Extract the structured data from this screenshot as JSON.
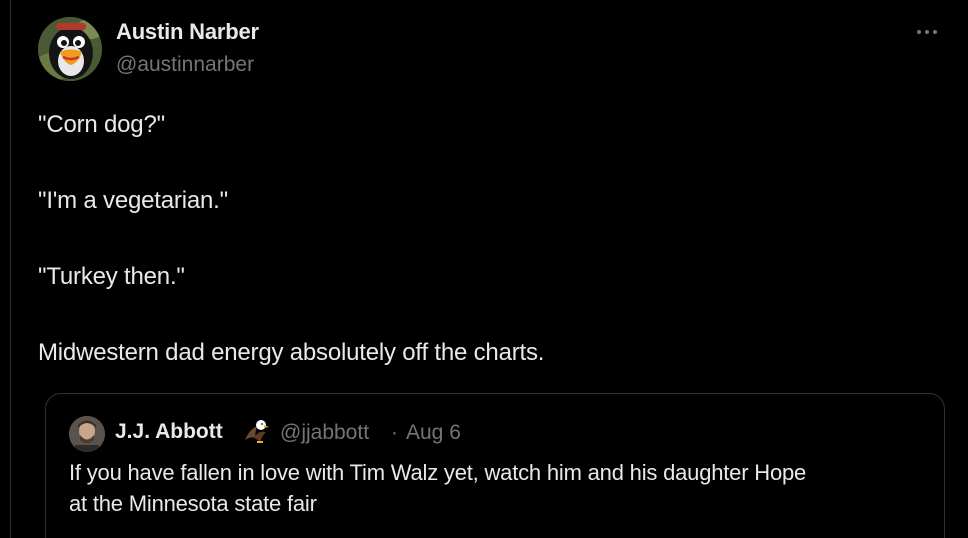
{
  "tweet": {
    "author": {
      "display_name": "Austin Narber",
      "handle": "@austinnarber",
      "avatar_icon": "penguin-avatar-icon"
    },
    "more_icon": "more-horizontal-icon",
    "lines": [
      "\"Corn dog?\"",
      "\"I'm a vegetarian.\"",
      "\"Turkey then.\"",
      "Midwestern dad energy absolutely off the charts."
    ]
  },
  "quoted_tweet": {
    "display_name": "J.J. Abbott",
    "badge_icon": "eagle-emoji-icon",
    "handle": "@jjabbott",
    "separator": "·",
    "date": "Aug 6",
    "text_lines": [
      "If you have fallen in love with Tim Walz yet, watch him and his daughter Hope",
      "at the Minnesota state fair"
    ]
  },
  "colors": {
    "background": "#000000",
    "primary_text": "#e7e9ea",
    "secondary_text": "#71767b",
    "border": "#2f3336"
  }
}
